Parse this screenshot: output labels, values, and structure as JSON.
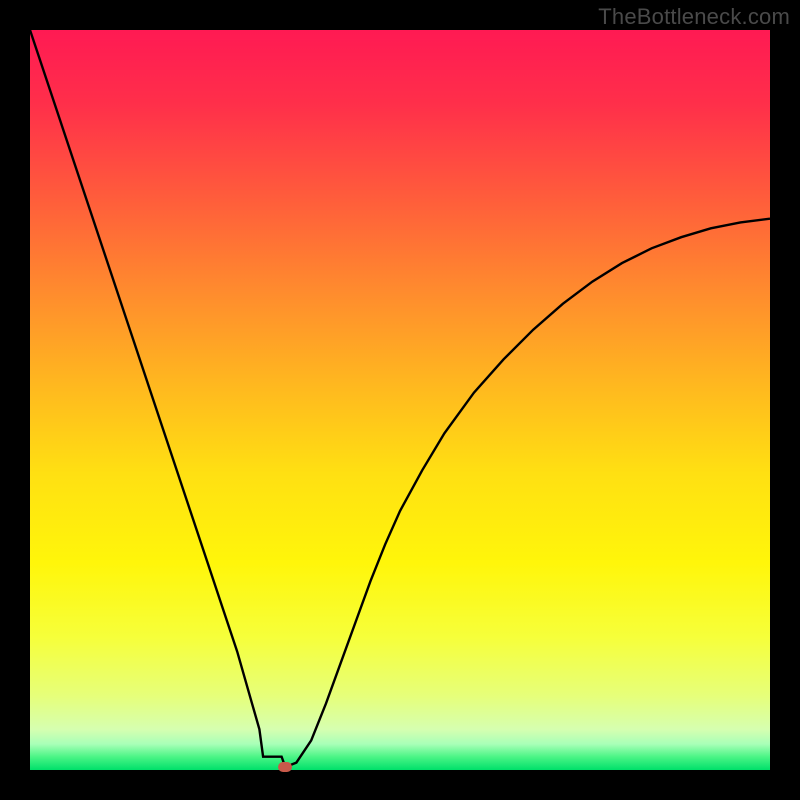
{
  "watermark": "TheBottleneck.com",
  "colors": {
    "frame": "#000000",
    "curve": "#000000",
    "marker": "#c85a4a"
  },
  "gradient_stops": [
    {
      "offset": 0.0,
      "color": "#ff1a53"
    },
    {
      "offset": 0.1,
      "color": "#ff2f4a"
    },
    {
      "offset": 0.22,
      "color": "#ff5a3c"
    },
    {
      "offset": 0.35,
      "color": "#ff8a2e"
    },
    {
      "offset": 0.48,
      "color": "#ffb81f"
    },
    {
      "offset": 0.6,
      "color": "#ffe012"
    },
    {
      "offset": 0.72,
      "color": "#fff60a"
    },
    {
      "offset": 0.82,
      "color": "#f6ff3a"
    },
    {
      "offset": 0.9,
      "color": "#e6ff7a"
    },
    {
      "offset": 0.945,
      "color": "#d6ffb0"
    },
    {
      "offset": 0.965,
      "color": "#a8ffb8"
    },
    {
      "offset": 0.982,
      "color": "#4cf586"
    },
    {
      "offset": 1.0,
      "color": "#00e06a"
    }
  ],
  "chart_data": {
    "type": "line",
    "title": "",
    "xlabel": "",
    "ylabel": "",
    "xlim": [
      0,
      100
    ],
    "ylim": [
      0,
      100
    ],
    "grid": false,
    "legend": false,
    "axes_visible": false,
    "series": [
      {
        "name": "bottleneck",
        "x": [
          0,
          2,
          4,
          6,
          8,
          10,
          12,
          14,
          16,
          18,
          20,
          22,
          24,
          26,
          28,
          30,
          31,
          32,
          33,
          34.5,
          36,
          38,
          40,
          42,
          44,
          46,
          48,
          50,
          53,
          56,
          60,
          64,
          68,
          72,
          76,
          80,
          84,
          88,
          92,
          96,
          100
        ],
        "y": [
          100,
          94,
          88,
          82,
          76,
          70,
          64,
          58,
          52,
          46,
          40,
          34,
          28,
          22,
          16,
          9,
          5.5,
          2.6,
          1.2,
          0.4,
          1.0,
          4.0,
          9.0,
          14.5,
          20.0,
          25.5,
          30.5,
          35.0,
          40.5,
          45.5,
          51.0,
          55.5,
          59.5,
          63.0,
          66.0,
          68.5,
          70.5,
          72.0,
          73.2,
          74.0,
          74.5
        ]
      }
    ],
    "marker": {
      "x": 34.5,
      "y": 0.4
    },
    "notch": {
      "x_start": 31.5,
      "x_end": 34.0,
      "y": 1.8
    },
    "description": "V-shaped curve over a vertical rainbow gradient. Left arm descends nearly linearly from (0,100) to a minimum near x≈34.5, y≈0.4. Right arm rises with decreasing slope, asymptoting near y≈75 at x=100. No visible axes, ticks, or labels."
  }
}
